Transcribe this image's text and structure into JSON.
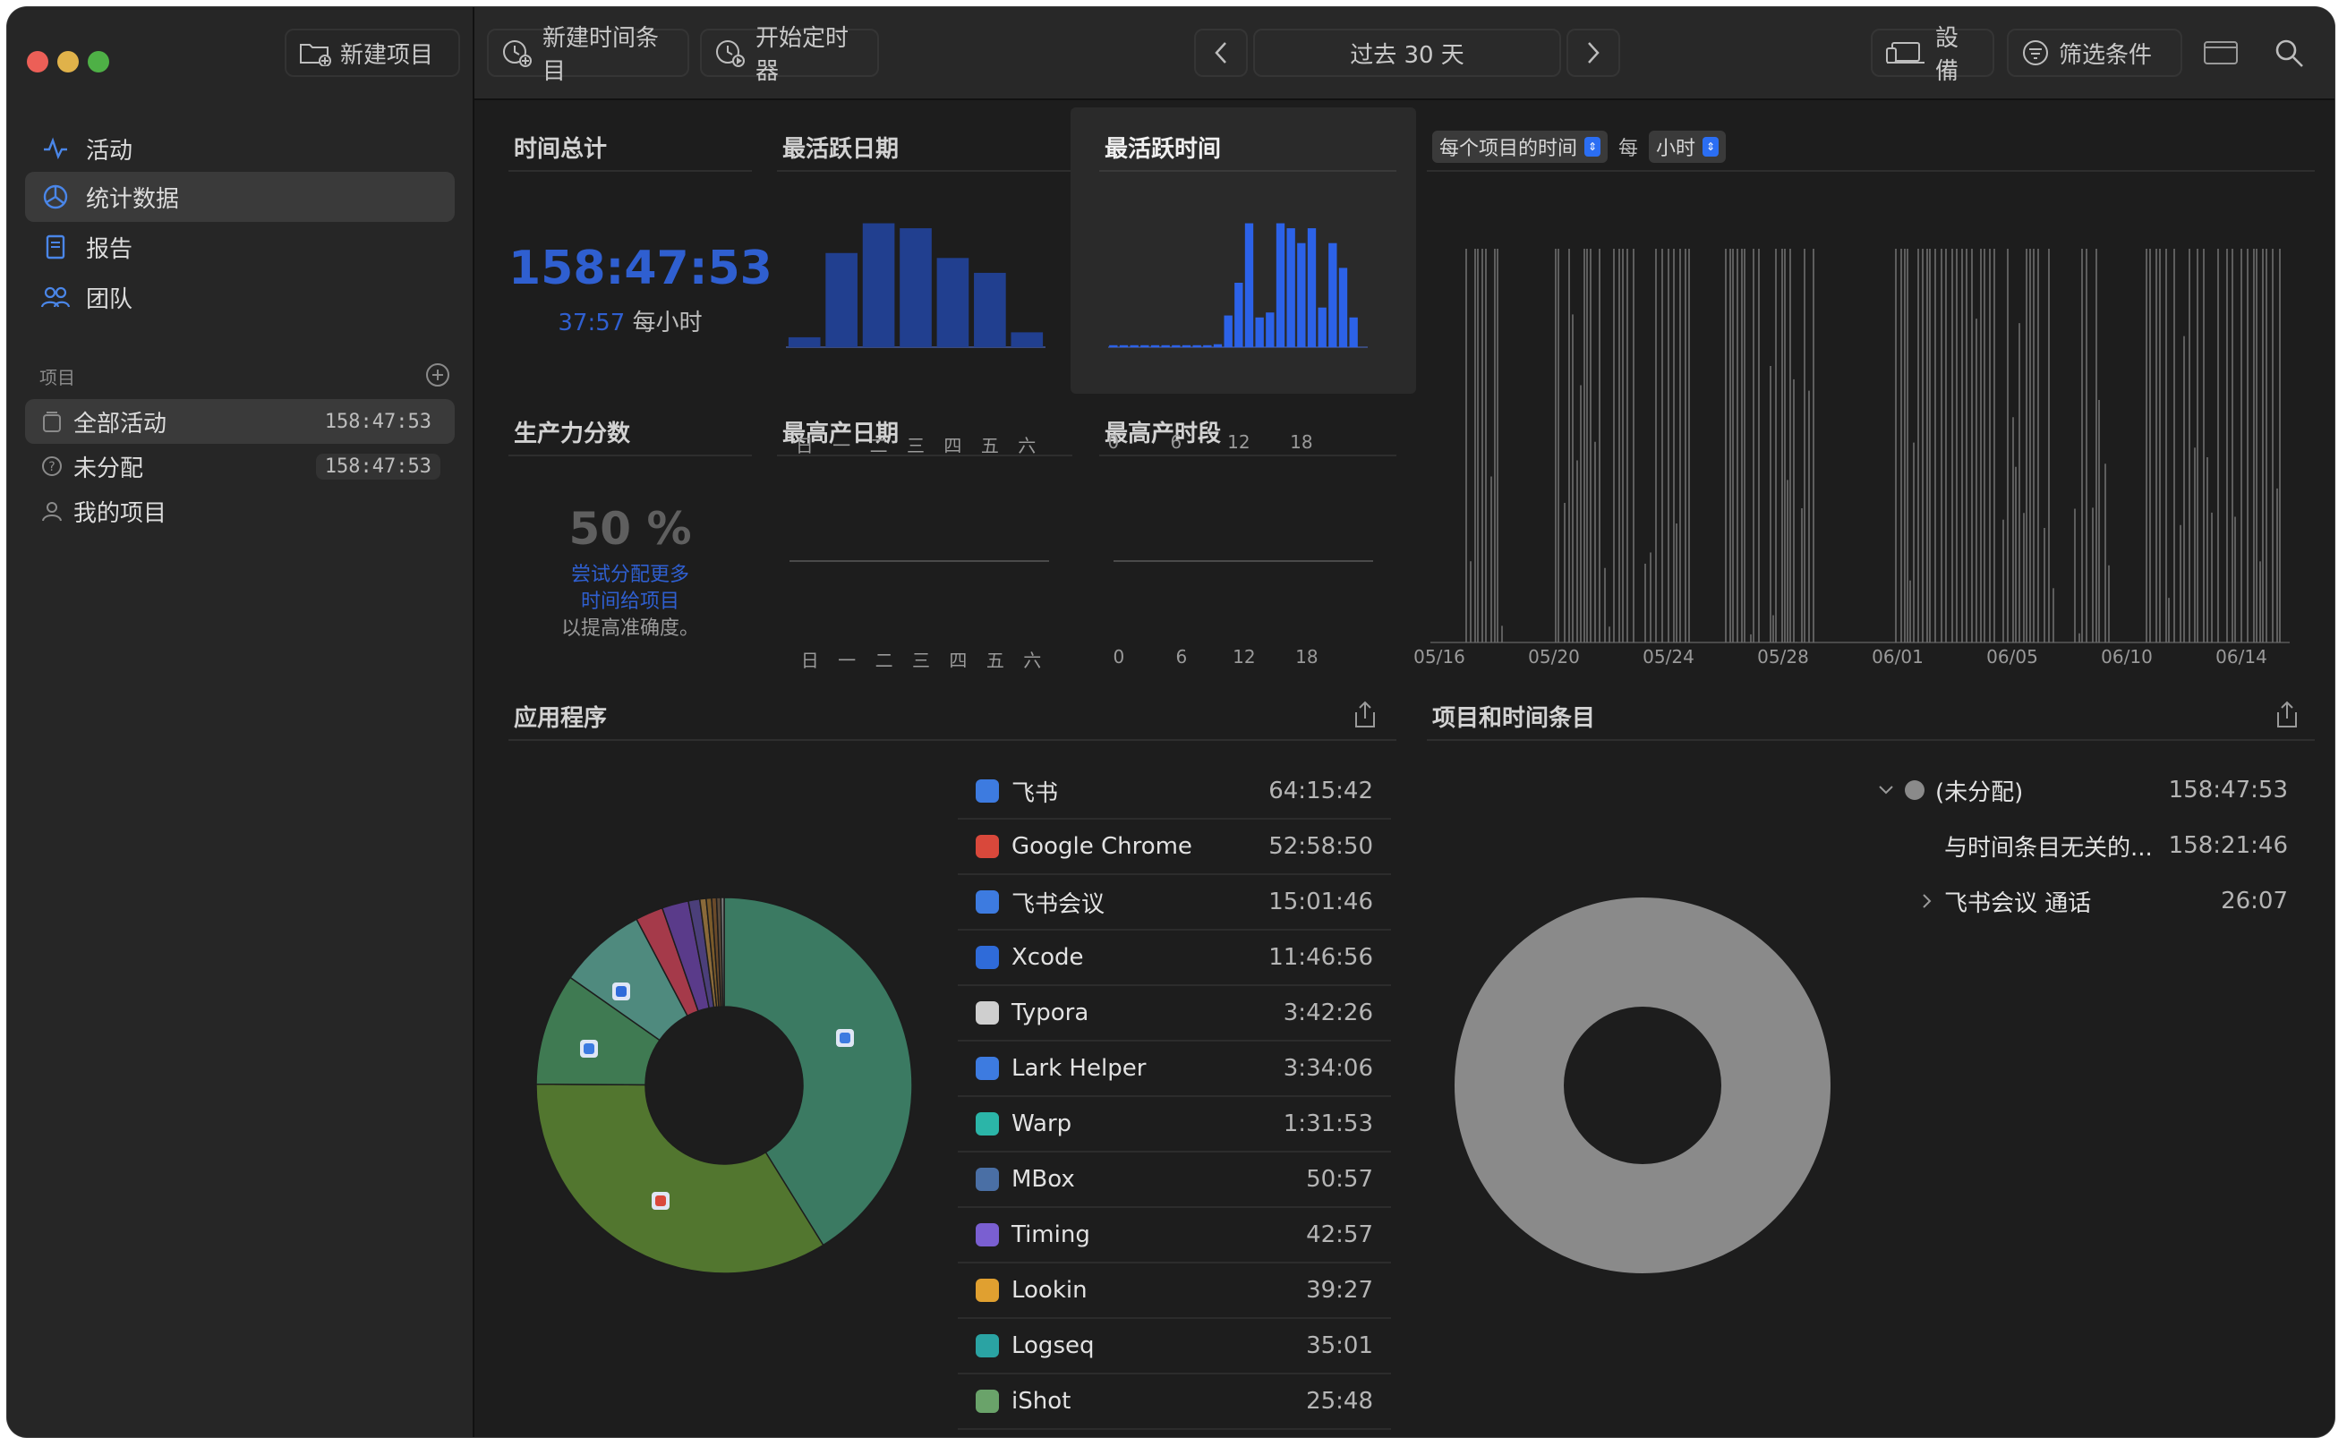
{
  "toolbar": {
    "new_project": "新建项目",
    "new_time_entry": "新建时间条目",
    "start_timer": "开始定时器",
    "period": "过去 30 天",
    "devices": "設備",
    "filter": "筛选条件"
  },
  "sidebar": {
    "nav": [
      {
        "label": "活动",
        "icon": "activity-icon"
      },
      {
        "label": "统计数据",
        "icon": "stats-icon"
      },
      {
        "label": "报告",
        "icon": "report-icon"
      },
      {
        "label": "团队",
        "icon": "team-icon"
      }
    ],
    "projects_header": "项目",
    "projects": [
      {
        "label": "全部活动",
        "time": "158:47:53",
        "icon": "stack-icon"
      },
      {
        "label": "未分配",
        "time": "158:47:53",
        "icon": "question-circle-icon"
      },
      {
        "label": "我的项目",
        "time": "",
        "icon": "person-icon"
      }
    ]
  },
  "stats": {
    "total_title": "时间总计",
    "total_value": "158:47:53",
    "per_hour_value": "37:57",
    "per_hour_label": "每小时",
    "active_day_title": "最活跃日期",
    "active_time_title": "最活跃时间",
    "productivity_title": "生产力分数",
    "productivity_value": "50 %",
    "productivity_hint_1": "尝试分配更多",
    "productivity_hint_2": "时间给项目",
    "productivity_hint_3": "以提高准确度。",
    "productive_day_title": "最高产日期",
    "productive_time_title": "最高产时段",
    "weekday_ticks": [
      "日",
      "一",
      "二",
      "三",
      "四",
      "五",
      "六"
    ],
    "hour_ticks": [
      "0",
      "6",
      "12",
      "18"
    ],
    "timeline_selector": "每个项目的时间",
    "per_word": "每",
    "unit_selector": "小时",
    "timeline_ticks": [
      "05/16",
      "05/20",
      "05/24",
      "05/28",
      "06/01",
      "06/05",
      "06/10",
      "06/14"
    ]
  },
  "apps": {
    "title": "应用程序",
    "items": [
      {
        "name": "飞书",
        "time": "64:15:42",
        "color": "#3d7be0"
      },
      {
        "name": "Google Chrome",
        "time": "52:58:50",
        "color": "#d9483b"
      },
      {
        "name": "飞书会议",
        "time": "15:01:46",
        "color": "#3d7be0"
      },
      {
        "name": "Xcode",
        "time": "11:46:56",
        "color": "#2f6bd9"
      },
      {
        "name": "Typora",
        "time": "3:42:26",
        "color": "#cfcfcf"
      },
      {
        "name": "Lark Helper",
        "time": "3:34:06",
        "color": "#3d7be0"
      },
      {
        "name": "Warp",
        "time": "1:31:53",
        "color": "#2bb5a8"
      },
      {
        "name": "MBox",
        "time": "50:57",
        "color": "#4a6fa5"
      },
      {
        "name": "Timing",
        "time": "42:57",
        "color": "#7a5fd1"
      },
      {
        "name": "Lookin",
        "time": "39:27",
        "color": "#e0a030"
      },
      {
        "name": "Logseq",
        "time": "35:01",
        "color": "#2aa3a3"
      },
      {
        "name": "iShot",
        "time": "25:48",
        "color": "#6aa36a"
      }
    ]
  },
  "projects_panel": {
    "title": "项目和时间条目",
    "rows": [
      {
        "label": "(未分配)",
        "time": "158:47:53"
      },
      {
        "label": "与时间条目无关的...",
        "time": "158:21:46"
      },
      {
        "label": "飞书会议 通话",
        "time": "26:07"
      }
    ]
  },
  "chart_data": [
    {
      "type": "bar",
      "title": "最活跃日期",
      "categories": [
        "日",
        "一",
        "二",
        "三",
        "四",
        "五",
        "六"
      ],
      "values": [
        1,
        9.5,
        12.5,
        12,
        9,
        7.5,
        1.5
      ]
    },
    {
      "type": "bar",
      "title": "最活跃时间",
      "categories": [
        "0",
        "1",
        "2",
        "3",
        "4",
        "5",
        "6",
        "7",
        "8",
        "9",
        "10",
        "11",
        "12",
        "13",
        "14",
        "15",
        "16",
        "17",
        "18",
        "19",
        "20",
        "21",
        "22",
        "23"
      ],
      "values": [
        0.2,
        0.2,
        0.2,
        0.2,
        0.2,
        0.2,
        0.2,
        0.2,
        0.2,
        0.2,
        0.3,
        3.2,
        6.5,
        12.5,
        3,
        3.5,
        12.5,
        12,
        10.5,
        12,
        4,
        10.5,
        8,
        3
      ]
    },
    {
      "type": "pie",
      "title": "应用程序",
      "categories": [
        "飞书",
        "Google Chrome",
        "飞书会议",
        "Xcode",
        "Typora",
        "Lark Helper",
        "Warp",
        "MBox",
        "Timing",
        "Lookin",
        "Logseq",
        "iShot"
      ],
      "values": [
        64.26,
        52.98,
        15.03,
        11.78,
        3.71,
        3.57,
        1.53,
        0.85,
        0.72,
        0.66,
        0.58,
        0.43
      ],
      "colors": [
        "#3b7a62",
        "#52762f",
        "#3f7a52",
        "#4f8a7e",
        "#a53a4a",
        "#5a3b8a",
        "#4b3f7a",
        "#8a6a3a",
        "#7a5a2a",
        "#6a4a2a",
        "#5a4a3a",
        "#7a7a7a"
      ]
    },
    {
      "type": "pie",
      "title": "项目和时间条目",
      "categories": [
        "(未分配)"
      ],
      "values": [
        158.8
      ],
      "colors": [
        "#8a8a8a"
      ]
    }
  ]
}
